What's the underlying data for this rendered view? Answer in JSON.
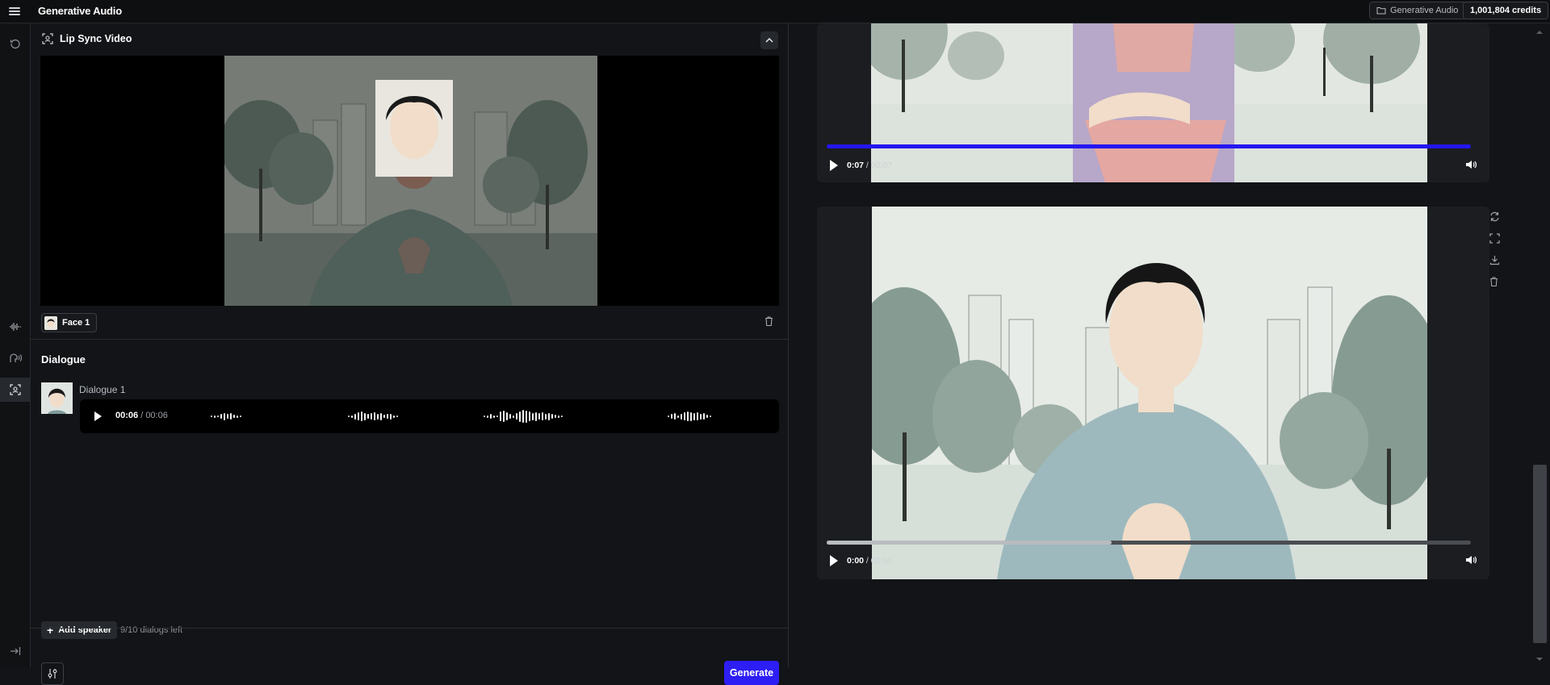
{
  "app": {
    "title": "Generative Audio",
    "project_label": "Generative Audio",
    "credits": "1,001,804 credits"
  },
  "section": {
    "title": "Lip Sync Video"
  },
  "faces": [
    {
      "label": "Face 1"
    }
  ],
  "dialogue": {
    "title": "Dialogue",
    "items": [
      {
        "name": "Dialogue 1",
        "current": "00:06",
        "separator": " / ",
        "duration": "00:06"
      }
    ]
  },
  "footer": {
    "add_speaker": "Add speaker",
    "dialogs_left": "9/10 dialogs left",
    "generate": "Generate"
  },
  "results": [
    {
      "current": "0:07",
      "separator": " / ",
      "duration": "00:07",
      "progress": 1.0
    },
    {
      "current": "0:00",
      "separator": " / ",
      "duration": "00:06",
      "progress": 0.0,
      "buffered": 0.44
    }
  ],
  "icons": {
    "rail": [
      "history-icon",
      "waveform-icon",
      "voice-icon",
      "lipsync-icon",
      "collapse-sidebar-icon"
    ],
    "result_actions": [
      "regenerate-icon",
      "fullscreen-icon",
      "download-icon",
      "delete-icon"
    ]
  },
  "colors": {
    "accent": "#2d1ef5",
    "progress": "#2416f0"
  }
}
